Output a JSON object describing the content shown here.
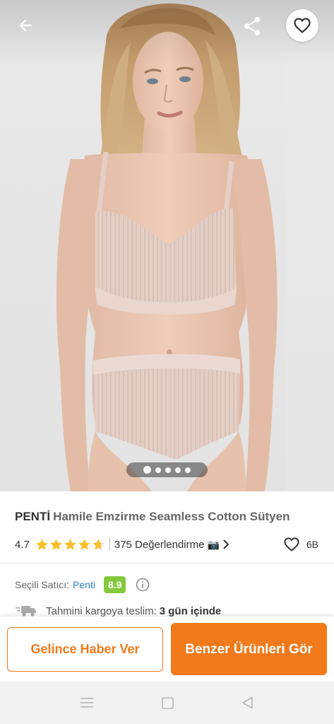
{
  "header": {
    "back_icon": "arrow-left-icon",
    "share_icon": "share-icon",
    "favorite_icon": "heart-outline-icon"
  },
  "gallery": {
    "image_count": 5,
    "active_index": 0
  },
  "product": {
    "brand": "PENTİ",
    "name": "Hamile Emzirme Seamless Cotton Sütyen",
    "rating": "4.7",
    "rating_stars": 4.7,
    "reviews_label": "375 Değerlendirme",
    "reviews_camera_icon": "📷",
    "favorites_count": "6B"
  },
  "seller": {
    "label": "Seçili Satıcı:",
    "name": "Penti",
    "score": "8.9"
  },
  "delivery": {
    "label": "Tahmini kargoya teslim:",
    "value": "3 gün içinde"
  },
  "actions": {
    "notify_label": "Gelince Haber Ver",
    "similar_label": "Benzer Ürünleri Gör"
  },
  "colors": {
    "accent": "#f27a1a",
    "star": "#fbbf2c",
    "link": "#2a7ec8",
    "score_badge": "#86c93e"
  }
}
